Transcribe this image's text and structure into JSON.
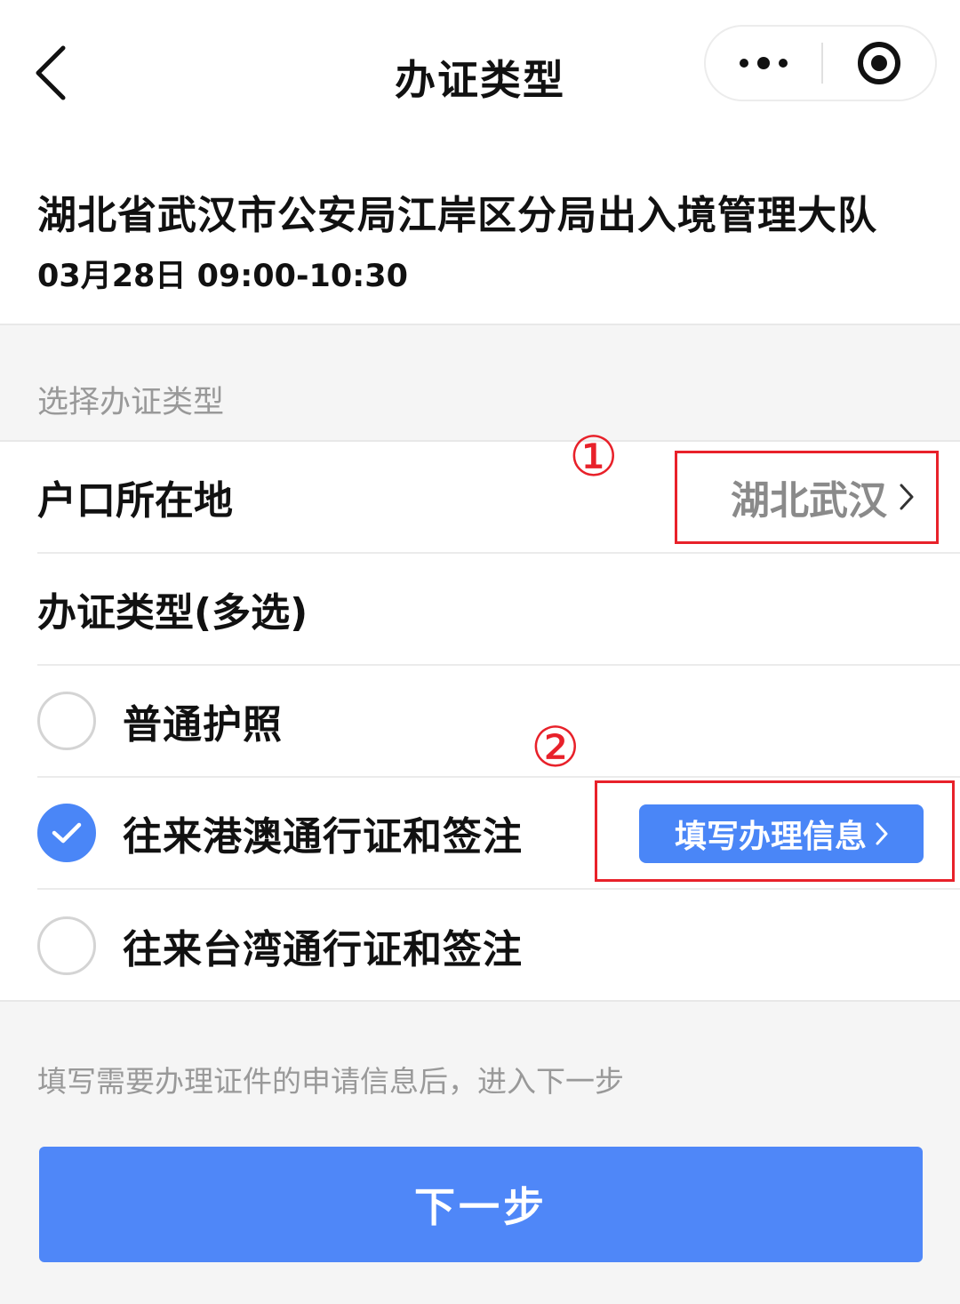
{
  "nav": {
    "title": "办证类型",
    "back_icon": "chevron-left-icon",
    "more_icon": "more-dots-icon",
    "close_icon": "target-circle-icon"
  },
  "header": {
    "office_name": "湖北省武汉市公安局江岸区分局出入境管理大队",
    "time_slot": "03月28日 09:00-10:30"
  },
  "section": {
    "label": "选择办证类型"
  },
  "form": {
    "residence": {
      "label": "户口所在地",
      "value": "湖北武汉"
    },
    "type_header": "办证类型(多选)",
    "options": [
      {
        "label": "普通护照",
        "checked": false
      },
      {
        "label": "往来港澳通行证和签注",
        "checked": true,
        "action_label": "填写办理信息"
      },
      {
        "label": "往来台湾通行证和签注",
        "checked": false
      }
    ]
  },
  "annotations": {
    "marker_1": "①",
    "marker_2": "②",
    "color": "#e8212a"
  },
  "footer": {
    "hint": "填写需要办理证件的申请信息后，进入下一步",
    "next_label": "下一步"
  },
  "colors": {
    "primary": "#4a86f7",
    "annotation": "#e8212a",
    "muted_text": "#999999"
  }
}
